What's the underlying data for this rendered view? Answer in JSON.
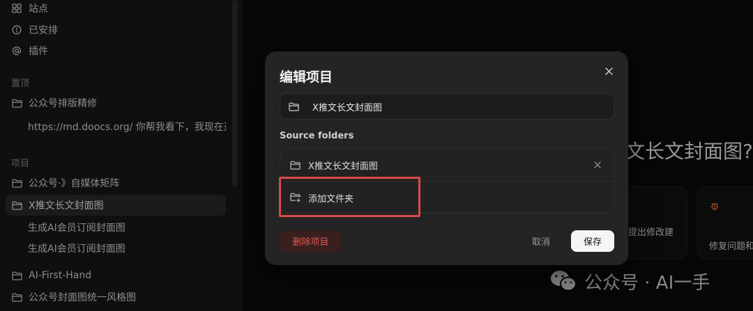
{
  "sidebar": {
    "top_items": [
      {
        "label": "站点",
        "icon": "grid-icon"
      },
      {
        "label": "已安排",
        "icon": "clock-icon"
      },
      {
        "label": "插件",
        "icon": "at-icon"
      }
    ],
    "pinned_label": "置顶",
    "pinned_items": [
      {
        "label": "公众号排版精修",
        "icon": "folder-icon"
      },
      {
        "label": "https://md.doocs.org/ 你帮我看下，我现在这"
      }
    ],
    "projects_label": "项目",
    "project_items": [
      {
        "label": "公众号·》自媒体矩阵",
        "icon": "folder-icon"
      },
      {
        "label": "X推文长文封面图",
        "icon": "folder-icon",
        "active": true
      },
      {
        "label": "生成AI会员订阅封面图"
      },
      {
        "label": "生成AI会员订阅封面图"
      },
      {
        "label": "AI-First-Hand",
        "icon": "folder-icon"
      },
      {
        "label": "公众号封面图统一风格图",
        "icon": "folder-icon"
      }
    ]
  },
  "main": {
    "heading": "文长文封面图?",
    "cards": [
      {
        "text": "提出修改建"
      },
      {
        "text": "修复问题和"
      }
    ],
    "watermark": "公众号 · AI一手"
  },
  "modal": {
    "title": "编辑项目",
    "name_value": "X推文长文封面图",
    "source_folders_label": "Source folders",
    "folders": [
      {
        "label": "X推文长文封面图"
      }
    ],
    "add_folder_label": "添加文件夹",
    "delete_label": "删除项目",
    "cancel_label": "取消",
    "save_label": "保存"
  },
  "colors": {
    "accent_danger": "#e0554f",
    "highlight": "#d94a4a",
    "save_bg": "#f5f5f5"
  }
}
